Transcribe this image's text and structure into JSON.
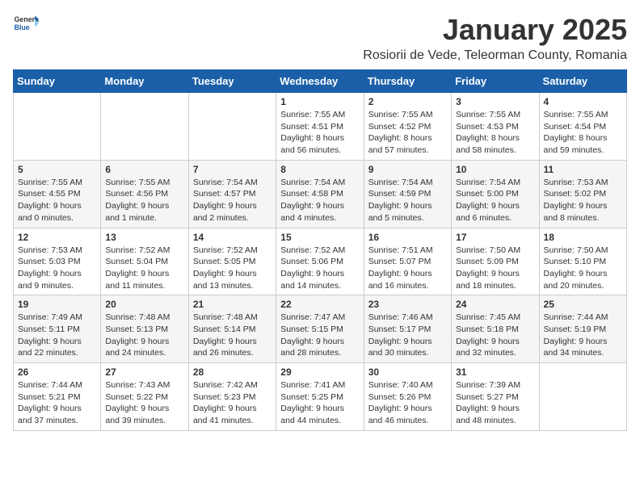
{
  "header": {
    "logo_general": "General",
    "logo_blue": "Blue",
    "title": "January 2025",
    "subtitle": "Rosiorii de Vede, Teleorman County, Romania"
  },
  "weekdays": [
    "Sunday",
    "Monday",
    "Tuesday",
    "Wednesday",
    "Thursday",
    "Friday",
    "Saturday"
  ],
  "weeks": [
    [
      {
        "day": "",
        "info": ""
      },
      {
        "day": "",
        "info": ""
      },
      {
        "day": "",
        "info": ""
      },
      {
        "day": "1",
        "info": "Sunrise: 7:55 AM\nSunset: 4:51 PM\nDaylight: 8 hours and 56 minutes."
      },
      {
        "day": "2",
        "info": "Sunrise: 7:55 AM\nSunset: 4:52 PM\nDaylight: 8 hours and 57 minutes."
      },
      {
        "day": "3",
        "info": "Sunrise: 7:55 AM\nSunset: 4:53 PM\nDaylight: 8 hours and 58 minutes."
      },
      {
        "day": "4",
        "info": "Sunrise: 7:55 AM\nSunset: 4:54 PM\nDaylight: 8 hours and 59 minutes."
      }
    ],
    [
      {
        "day": "5",
        "info": "Sunrise: 7:55 AM\nSunset: 4:55 PM\nDaylight: 9 hours and 0 minutes."
      },
      {
        "day": "6",
        "info": "Sunrise: 7:55 AM\nSunset: 4:56 PM\nDaylight: 9 hours and 1 minute."
      },
      {
        "day": "7",
        "info": "Sunrise: 7:54 AM\nSunset: 4:57 PM\nDaylight: 9 hours and 2 minutes."
      },
      {
        "day": "8",
        "info": "Sunrise: 7:54 AM\nSunset: 4:58 PM\nDaylight: 9 hours and 4 minutes."
      },
      {
        "day": "9",
        "info": "Sunrise: 7:54 AM\nSunset: 4:59 PM\nDaylight: 9 hours and 5 minutes."
      },
      {
        "day": "10",
        "info": "Sunrise: 7:54 AM\nSunset: 5:00 PM\nDaylight: 9 hours and 6 minutes."
      },
      {
        "day": "11",
        "info": "Sunrise: 7:53 AM\nSunset: 5:02 PM\nDaylight: 9 hours and 8 minutes."
      }
    ],
    [
      {
        "day": "12",
        "info": "Sunrise: 7:53 AM\nSunset: 5:03 PM\nDaylight: 9 hours and 9 minutes."
      },
      {
        "day": "13",
        "info": "Sunrise: 7:52 AM\nSunset: 5:04 PM\nDaylight: 9 hours and 11 minutes."
      },
      {
        "day": "14",
        "info": "Sunrise: 7:52 AM\nSunset: 5:05 PM\nDaylight: 9 hours and 13 minutes."
      },
      {
        "day": "15",
        "info": "Sunrise: 7:52 AM\nSunset: 5:06 PM\nDaylight: 9 hours and 14 minutes."
      },
      {
        "day": "16",
        "info": "Sunrise: 7:51 AM\nSunset: 5:07 PM\nDaylight: 9 hours and 16 minutes."
      },
      {
        "day": "17",
        "info": "Sunrise: 7:50 AM\nSunset: 5:09 PM\nDaylight: 9 hours and 18 minutes."
      },
      {
        "day": "18",
        "info": "Sunrise: 7:50 AM\nSunset: 5:10 PM\nDaylight: 9 hours and 20 minutes."
      }
    ],
    [
      {
        "day": "19",
        "info": "Sunrise: 7:49 AM\nSunset: 5:11 PM\nDaylight: 9 hours and 22 minutes."
      },
      {
        "day": "20",
        "info": "Sunrise: 7:48 AM\nSunset: 5:13 PM\nDaylight: 9 hours and 24 minutes."
      },
      {
        "day": "21",
        "info": "Sunrise: 7:48 AM\nSunset: 5:14 PM\nDaylight: 9 hours and 26 minutes."
      },
      {
        "day": "22",
        "info": "Sunrise: 7:47 AM\nSunset: 5:15 PM\nDaylight: 9 hours and 28 minutes."
      },
      {
        "day": "23",
        "info": "Sunrise: 7:46 AM\nSunset: 5:17 PM\nDaylight: 9 hours and 30 minutes."
      },
      {
        "day": "24",
        "info": "Sunrise: 7:45 AM\nSunset: 5:18 PM\nDaylight: 9 hours and 32 minutes."
      },
      {
        "day": "25",
        "info": "Sunrise: 7:44 AM\nSunset: 5:19 PM\nDaylight: 9 hours and 34 minutes."
      }
    ],
    [
      {
        "day": "26",
        "info": "Sunrise: 7:44 AM\nSunset: 5:21 PM\nDaylight: 9 hours and 37 minutes."
      },
      {
        "day": "27",
        "info": "Sunrise: 7:43 AM\nSunset: 5:22 PM\nDaylight: 9 hours and 39 minutes."
      },
      {
        "day": "28",
        "info": "Sunrise: 7:42 AM\nSunset: 5:23 PM\nDaylight: 9 hours and 41 minutes."
      },
      {
        "day": "29",
        "info": "Sunrise: 7:41 AM\nSunset: 5:25 PM\nDaylight: 9 hours and 44 minutes."
      },
      {
        "day": "30",
        "info": "Sunrise: 7:40 AM\nSunset: 5:26 PM\nDaylight: 9 hours and 46 minutes."
      },
      {
        "day": "31",
        "info": "Sunrise: 7:39 AM\nSunset: 5:27 PM\nDaylight: 9 hours and 48 minutes."
      },
      {
        "day": "",
        "info": ""
      }
    ]
  ]
}
